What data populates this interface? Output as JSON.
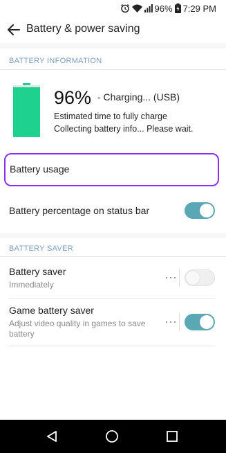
{
  "status_bar": {
    "battery_percent": "96%",
    "time": "7:29 PM",
    "icons": [
      "alarm-icon",
      "wifi-icon",
      "signal-icon",
      "battery-charging-icon"
    ]
  },
  "app_bar": {
    "title": "Battery & power saving",
    "back_icon": "back-arrow-icon"
  },
  "battery_information": {
    "header": "BATTERY INFORMATION",
    "level": "96%",
    "level_fraction": 0.96,
    "charging_status": "- Charging... (USB)",
    "estimate_line_1": "Estimated time to fully charge",
    "estimate_line_2": "Collecting battery info... Please wait.",
    "battery_color": "#1ed18f"
  },
  "battery_usage": {
    "label": "Battery usage",
    "highlight_color": "#8b2ff0"
  },
  "status_bar_percentage": {
    "label": "Battery percentage on status bar",
    "enabled": true
  },
  "battery_saver_section": {
    "header": "BATTERY SAVER",
    "items": [
      {
        "title": "Battery saver",
        "subtitle": "Immediately",
        "enabled": false
      },
      {
        "title": "Game battery saver",
        "subtitle": "Adjust video quality in games to save battery",
        "enabled": true
      }
    ]
  },
  "colors": {
    "toggle_on": "#5aa7b6",
    "section_header": "#7a9cc0"
  },
  "nav_bar": {
    "buttons": [
      "back-triangle-icon",
      "home-circle-icon",
      "recents-square-icon"
    ]
  }
}
